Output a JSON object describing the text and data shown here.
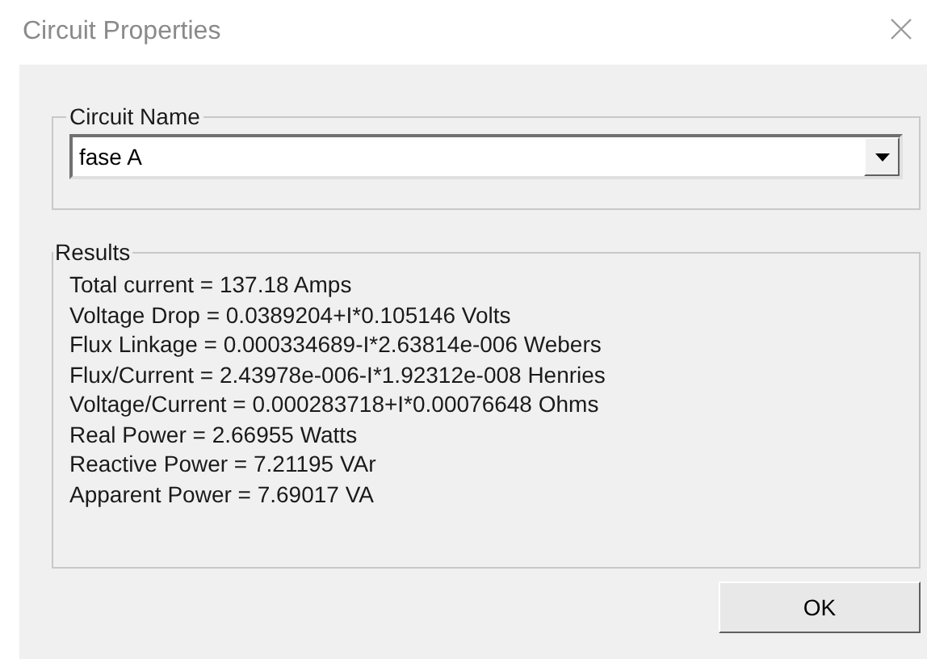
{
  "window": {
    "title": "Circuit Properties"
  },
  "circuit_name": {
    "label": "Circuit Name",
    "value": "fase A"
  },
  "results": {
    "label": "Results",
    "lines": [
      "Total current = 137.18 Amps",
      "Voltage Drop = 0.0389204+I*0.105146 Volts",
      "Flux Linkage = 0.000334689-I*2.63814e-006 Webers",
      "Flux/Current = 2.43978e-006-I*1.92312e-008 Henries",
      "Voltage/Current = 0.000283718+I*0.00076648 Ohms",
      "Real Power = 2.66955 Watts",
      "Reactive Power = 7.21195 VAr",
      "Apparent Power = 7.69017 VA"
    ]
  },
  "buttons": [
    "OK"
  ]
}
